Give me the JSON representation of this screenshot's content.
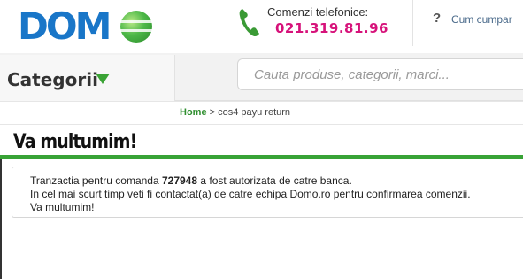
{
  "header": {
    "logo_text_do": "DO",
    "logo_text_m": "M",
    "phone_label": "Comenzi telefonice:",
    "phone_number": "021.319.81.96",
    "help_link": "Cum cumpar"
  },
  "nav": {
    "categories_label": "Categorii",
    "search_placeholder": "Cauta produse, categorii, marci..."
  },
  "breadcrumb": {
    "home": "Home",
    "separator": " > ",
    "current": "cos4 payu return"
  },
  "page": {
    "title": "Va multumim!",
    "message_line1_prefix": "Tranzactia pentru comanda ",
    "order_number": "727948",
    "message_line1_suffix": " a fost autorizata de catre banca.",
    "message_line2": "In cel mai scurt timp veti fi contactat(a) de catre echipa Domo.ro pentru confirmarea comenzii.",
    "message_line3": "Va multumim!"
  },
  "colors": {
    "brand_blue": "#1976c8",
    "brand_green": "#38a336",
    "phone_magenta": "#d6127a"
  },
  "icons": {
    "phone": "phone-icon",
    "help": "question-icon",
    "categories": "triangle-down-icon",
    "logo": "globe-icon"
  }
}
